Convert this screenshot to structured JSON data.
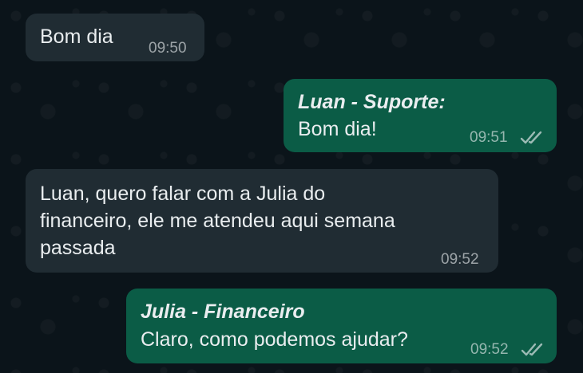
{
  "messages": [
    {
      "direction": "incoming",
      "text": "Bom dia",
      "time": "09:50"
    },
    {
      "direction": "outgoing",
      "sender": "Luan - Suporte:",
      "text": "Bom dia!",
      "time": "09:51",
      "status": "double-check-icon"
    },
    {
      "direction": "incoming",
      "text": "Luan, quero falar com a Julia do\nfinanceiro, ele me atendeu aqui semana\npassada",
      "time": "09:52"
    },
    {
      "direction": "outgoing",
      "sender": "Julia - Financeiro",
      "text": "Claro, como podemos ajudar?",
      "time": "09:52",
      "status": "double-check-icon"
    }
  ],
  "colors": {
    "background": "#0b141a",
    "incoming_bubble": "#202c33",
    "outgoing_bubble": "#0b5c46",
    "text": "#e9edef"
  }
}
